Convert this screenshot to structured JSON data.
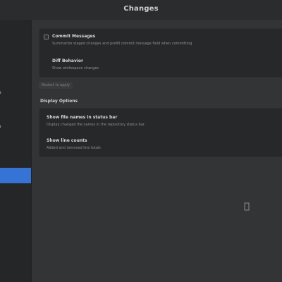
{
  "window": {
    "title": "Changes"
  },
  "sidebar": {
    "items": [
      {
        "label": "s"
      },
      {
        "label": "s"
      },
      {
        "label": ""
      }
    ]
  },
  "group1": {
    "rows": [
      {
        "title": "Commit Messages",
        "subtitle": "Summarize staged changes and prefill commit message field when committing"
      },
      {
        "title": "Diff Behavior",
        "subtitle": "Show whitespace changes"
      }
    ]
  },
  "hint": {
    "text": "Restart to apply"
  },
  "section2": {
    "heading": "Display Options"
  },
  "group2": {
    "rows": [
      {
        "title": "Show file names in status bar",
        "subtitle": "Display changed file names in the repository status bar"
      },
      {
        "title": "Show line counts",
        "subtitle": "Added and removed line totals"
      }
    ]
  }
}
